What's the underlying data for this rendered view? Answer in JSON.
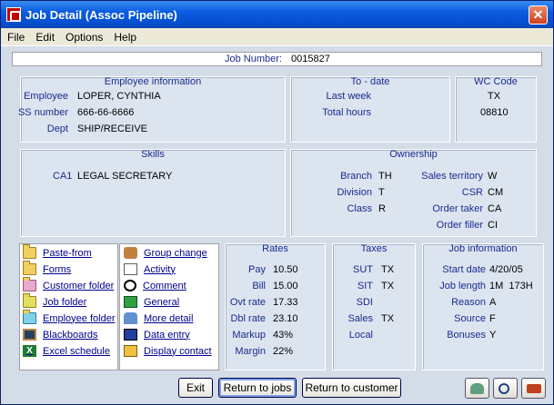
{
  "window": {
    "title": "Job Detail (Assoc Pipeline)",
    "close_label": "✕"
  },
  "menu": [
    "File",
    "Edit",
    "Options",
    "Help"
  ],
  "job": {
    "label": "Job Number:",
    "value": "0015827"
  },
  "employee": {
    "title": "Employee information",
    "name_label": "Employee",
    "name": "LOPER, CYNTHIA",
    "ssn_label": "SS number",
    "ssn": "666-66-6666",
    "dept_label": "Dept",
    "dept": "SHIP/RECEIVE"
  },
  "todate": {
    "title": "To - date",
    "last_week_label": "Last week",
    "total_hours_label": "Total hours"
  },
  "wc": {
    "title": "WC Code",
    "state": "TX",
    "code": "08810"
  },
  "skills": {
    "title": "Skills",
    "code": "CA1",
    "desc": "LEGAL SECRETARY"
  },
  "ownership": {
    "title": "Ownership",
    "branch_label": "Branch",
    "branch": "TH",
    "division_label": "Division",
    "division": "T",
    "class_label": "Class",
    "class": "R",
    "sales_territory_label": "Sales territory",
    "sales_territory": "W",
    "csr_label": "CSR",
    "csr": "CM",
    "order_taker_label": "Order taker",
    "order_taker": "CA",
    "order_filler_label": "Order filler",
    "order_filler": "CI"
  },
  "links_left": [
    {
      "label": "Paste-from",
      "icon": "folder-icon"
    },
    {
      "label": "Forms",
      "icon": "folder-icon"
    },
    {
      "label": "Customer folder",
      "icon": "folder-icon"
    },
    {
      "label": "Job folder",
      "icon": "folder-icon"
    },
    {
      "label": "Employee folder",
      "icon": "folder-icon"
    },
    {
      "label": "Blackboards",
      "icon": "blackboard-icon"
    },
    {
      "label": "Excel schedule",
      "icon": "excel-icon"
    }
  ],
  "links_right": [
    {
      "label": "Group change",
      "icon": "group-change-icon"
    },
    {
      "label": "Activity",
      "icon": "document-icon"
    },
    {
      "label": "Comment",
      "icon": "comment-icon"
    },
    {
      "label": "General",
      "icon": "general-icon"
    },
    {
      "label": "More detail",
      "icon": "detail-icon"
    },
    {
      "label": "Data entry",
      "icon": "data-entry-icon"
    },
    {
      "label": "Display contact",
      "icon": "contact-icon"
    }
  ],
  "rates": {
    "title": "Rates",
    "pay_label": "Pay",
    "pay": "10.50",
    "bill_label": "Bill",
    "bill": "15.00",
    "ovt_label": "Ovt rate",
    "ovt": "17.33",
    "dbl_label": "Dbl rate",
    "dbl": "23.10",
    "markup_label": "Markup",
    "markup": "43%",
    "margin_label": "Margin",
    "margin": "22%"
  },
  "taxes": {
    "title": "Taxes",
    "sut_label": "SUT",
    "sut": "TX",
    "sit_label": "SIT",
    "sit": "TX",
    "sdi_label": "SDI",
    "sales_label": "Sales",
    "sales": "TX",
    "local_label": "Local"
  },
  "jobinfo": {
    "title": "Job information",
    "start_label": "Start date",
    "start": "4/20/05",
    "length_label": "Job length",
    "length": "1M  173H",
    "reason_label": "Reason",
    "reason": "A",
    "source_label": "Source",
    "source": "F",
    "bonuses_label": "Bonuses",
    "bonuses": "Y"
  },
  "buttons": {
    "exit": "Exit",
    "return_jobs": "Return to jobs",
    "return_customer": "Return to customer"
  },
  "colors": {
    "title_bar": "#0A5CE0",
    "panel": "#DCE4F0",
    "label": "#1A2B8C",
    "link": "#00008B"
  }
}
